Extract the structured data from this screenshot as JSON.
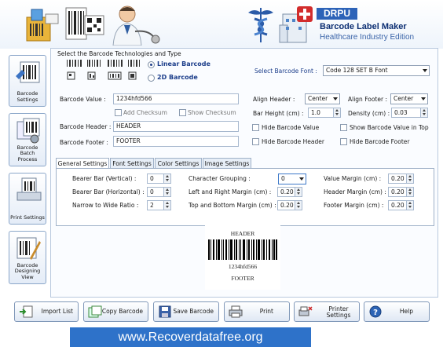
{
  "header": {
    "logo": "DRPU",
    "title": "Barcode Label Maker",
    "subtitle": "Healthcare Industry Edition"
  },
  "sidebar": {
    "items": [
      {
        "label": "Barcode Settings",
        "icon": "barcode-settings-icon"
      },
      {
        "label": "Barcode Batch Process",
        "icon": "batch-process-icon"
      },
      {
        "label": "Print Settings",
        "icon": "print-settings-icon"
      },
      {
        "label": "Barcode Designing View",
        "icon": "designing-view-icon"
      }
    ]
  },
  "technology": {
    "heading": "Select the Barcode Technologies and Type",
    "linear_label": "Linear Barcode",
    "twod_label": "2D Barcode",
    "selected": "Linear Barcode",
    "font_label": "Select Barcode Font :",
    "font_value": "Code 128 SET B Font"
  },
  "form": {
    "barcode_value_label": "Barcode Value :",
    "barcode_value": "1234hfd566",
    "add_checksum": "Add Checksum",
    "show_checksum": "Show Checksum",
    "barcode_header_label": "Barcode Header :",
    "barcode_header": "HEADER",
    "barcode_footer_label": "Barcode Footer :",
    "barcode_footer": "FOOTER",
    "align_header_label": "Align Header :",
    "align_header": "Center",
    "align_footer_label": "Align Footer :",
    "align_footer": "Center",
    "bar_height_label": "Bar Height (cm) :",
    "bar_height": "1.0",
    "density_label": "Density (cm) :",
    "density": "0.03",
    "hide_value": "Hide Barcode Value",
    "show_value_top": "Show Barcode Value in Top",
    "hide_header": "Hide Barcode Header",
    "hide_footer": "Hide Barcode Footer"
  },
  "tabs": [
    "General Settings",
    "Font Settings",
    "Color Settings",
    "Image Settings"
  ],
  "general": {
    "bearer_v_label": "Bearer Bar (Vertical) :",
    "bearer_v": "0",
    "bearer_h_label": "Bearer Bar (Horizontal) :",
    "bearer_h": "0",
    "ratio_label": "Narrow to Wide Ratio :",
    "ratio": "2",
    "char_group_label": "Character Grouping :",
    "char_group": "0",
    "lr_margin_label": "Left and Right Margin (cm) :",
    "lr_margin": "0.20",
    "tb_margin_label": "Top and Bottom Margin (cm) :",
    "tb_margin": "0.20",
    "value_margin_label": "Value Margin (cm) :",
    "value_margin": "0.20",
    "header_margin_label": "Header Margin (cm) :",
    "header_margin": "0.20",
    "footer_margin_label": "Footer Margin (cm) :",
    "footer_margin": "0.20"
  },
  "preview": {
    "header": "HEADER",
    "value": "1234hfd566",
    "footer": "FOOTER"
  },
  "toolbar": {
    "import": "Import List",
    "copy": "Copy Barcode",
    "save": "Save Barcode",
    "print": "Print",
    "printer": "Printer Settings",
    "help": "Help"
  },
  "footer": {
    "url": "www.Recoverdatafree.org"
  },
  "colors": {
    "accent": "#2d63b8",
    "footer_bg": "#2e72c9",
    "title": "#0d2f73"
  }
}
